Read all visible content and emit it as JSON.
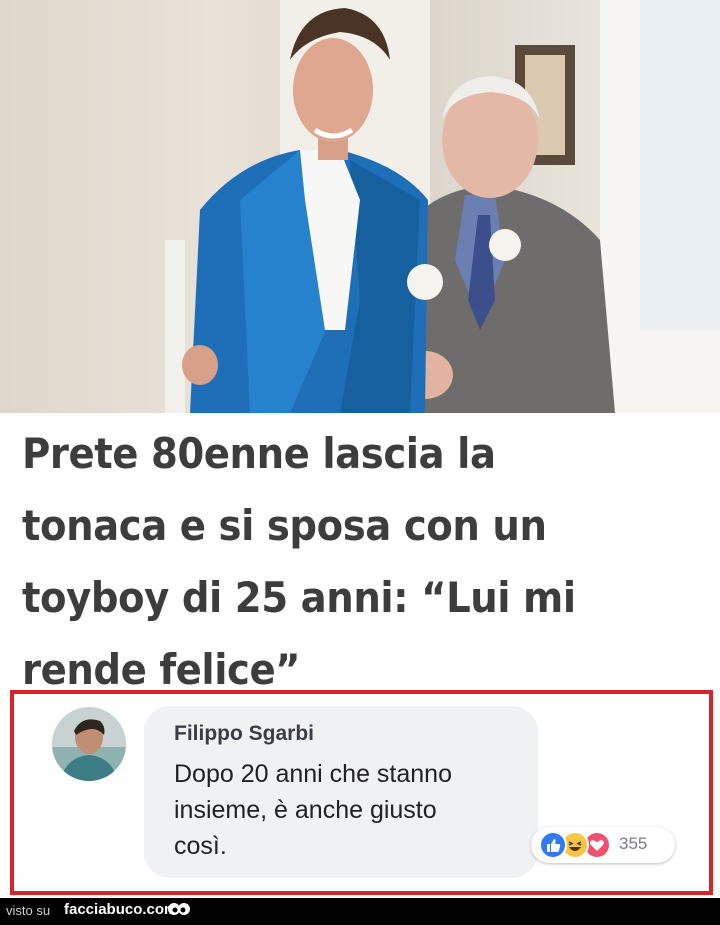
{
  "photo": {
    "subject_left": "young-man-blue-suit",
    "subject_right": "elderly-man-grey-suit"
  },
  "headline": {
    "line1": "Prete 80enne lascia la",
    "line2": "tonaca e si sposa con un",
    "line3": "toyboy di 25 anni: “Lui mi",
    "line4": "rende felice”"
  },
  "comment": {
    "author": "Filippo Sgarbi",
    "line1": "Dopo 20 anni che stanno",
    "line2": "insieme, è anche giusto",
    "line3": "così.",
    "reactions": [
      "like-icon",
      "haha-icon",
      "love-icon"
    ],
    "reaction_count": "355",
    "highlight_color": "#d9222a"
  },
  "footer": {
    "visto": "visto su",
    "site": "facciabuco.com"
  }
}
